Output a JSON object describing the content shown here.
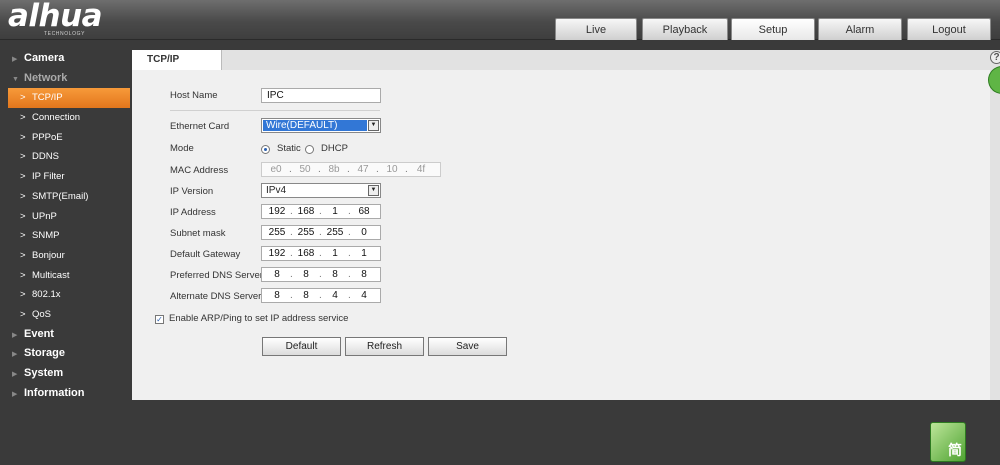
{
  "brand": {
    "logo": "alhua",
    "sub": "TECHNOLOGY"
  },
  "tabs": [
    {
      "label": "Live"
    },
    {
      "label": "Playback"
    },
    {
      "label": "Setup",
      "active": true
    },
    {
      "label": "Alarm"
    },
    {
      "label": "Logout"
    }
  ],
  "sidebar": {
    "camera": "Camera",
    "network": "Network",
    "sub": [
      "TCP/IP",
      "Connection",
      "PPPoE",
      "DDNS",
      "IP Filter",
      "SMTP(Email)",
      "UPnP",
      "SNMP",
      "Bonjour",
      "Multicast",
      "802.1x",
      "QoS"
    ],
    "event": "Event",
    "storage": "Storage",
    "system": "System",
    "information": "Information"
  },
  "content": {
    "tab": "TCP/IP",
    "help": "?",
    "labels": {
      "host": "Host Name",
      "card": "Ethernet Card",
      "mode": "Mode",
      "mac": "MAC Address",
      "ipver": "IP Version",
      "ip": "IP Address",
      "mask": "Subnet mask",
      "gw": "Default Gateway",
      "dns1": "Preferred DNS Server",
      "dns2": "Alternate DNS Server"
    },
    "host_value": "IPC",
    "card_value": "Wire(DEFAULT)",
    "mode_static": "Static",
    "mode_dhcp": "DHCP",
    "mac": [
      "e0",
      "50",
      "8b",
      "47",
      "10",
      "4f"
    ],
    "ipver_value": "IPv4",
    "ip": [
      "192",
      "168",
      "1",
      "68"
    ],
    "mask": [
      "255",
      "255",
      "255",
      "0"
    ],
    "gw": [
      "192",
      "168",
      "1",
      "1"
    ],
    "dns1": [
      "8",
      "8",
      "8",
      "8"
    ],
    "dns2": [
      "8",
      "8",
      "4",
      "4"
    ],
    "arp_label": "Enable ARP/Ping to set IP address service",
    "buttons": {
      "default": "Default",
      "refresh": "Refresh",
      "save": "Save"
    }
  },
  "lang_badge": "简"
}
